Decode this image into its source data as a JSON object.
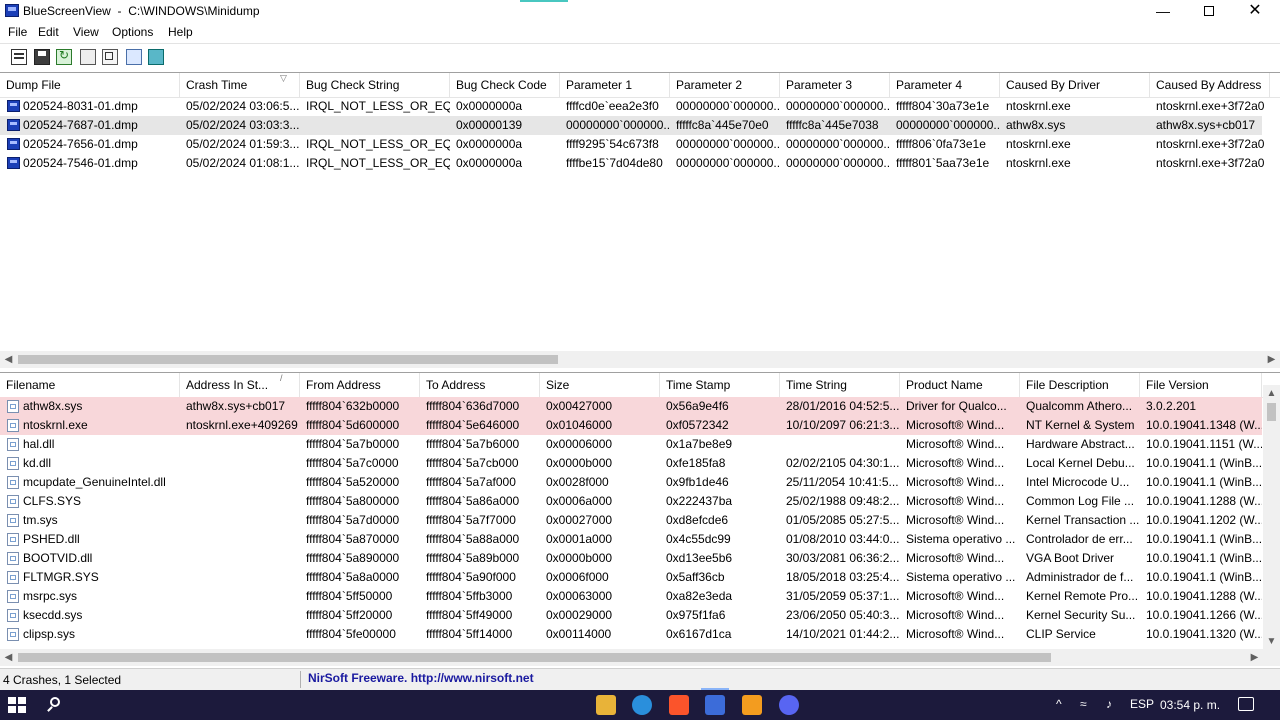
{
  "window": {
    "app_name": "BlueScreenView",
    "path": "C:\\WINDOWS\\Minidump",
    "minimize_glyph": "—",
    "close_glyph": "✕"
  },
  "menu": [
    "File",
    "Edit",
    "View",
    "Options",
    "Help"
  ],
  "toolbar_icons": [
    "properties-icon",
    "save-icon",
    "refresh-icon",
    "copy-icon",
    "options-icon",
    "find-icon",
    "exit-icon"
  ],
  "crash_list": {
    "columns": [
      "Dump File",
      "Crash Time",
      "Bug Check String",
      "Bug Check Code",
      "Parameter 1",
      "Parameter 2",
      "Parameter 3",
      "Parameter 4",
      "Caused By Driver",
      "Caused By Address"
    ],
    "sorted_column": "Crash Time",
    "selected_row": 1,
    "rows": [
      [
        "020524-8031-01.dmp",
        "05/02/2024 03:06:5...",
        "IRQL_NOT_LESS_OR_EQ...",
        "0x0000000a",
        "ffffcd0e`eea2e3f0",
        "00000000`000000...",
        "00000000`000000...",
        "fffff804`30a73e1e",
        "ntoskrnl.exe",
        "ntoskrnl.exe+3f72a0"
      ],
      [
        "020524-7687-01.dmp",
        "05/02/2024 03:03:3...",
        "",
        "0x00000139",
        "00000000`000000...",
        "fffffc8a`445e70e0",
        "fffffc8a`445e7038",
        "00000000`000000...",
        "athw8x.sys",
        "athw8x.sys+cb017"
      ],
      [
        "020524-7656-01.dmp",
        "05/02/2024 01:59:3...",
        "IRQL_NOT_LESS_OR_EQ...",
        "0x0000000a",
        "ffff9295`54c673f8",
        "00000000`000000...",
        "00000000`000000...",
        "fffff806`0fa73e1e",
        "ntoskrnl.exe",
        "ntoskrnl.exe+3f72a0"
      ],
      [
        "020524-7546-01.dmp",
        "05/02/2024 01:08:1...",
        "IRQL_NOT_LESS_OR_EQ...",
        "0x0000000a",
        "ffffbe15`7d04de80",
        "00000000`000000...",
        "00000000`000000...",
        "fffff801`5aa73e1e",
        "ntoskrnl.exe",
        "ntoskrnl.exe+3f72a0"
      ]
    ]
  },
  "driver_list": {
    "columns": [
      "Filename",
      "Address In St...",
      "From Address",
      "To Address",
      "Size",
      "Time Stamp",
      "Time String",
      "Product Name",
      "File Description",
      "File Version"
    ],
    "sorted_column": "Address In St...",
    "highlighted_rows": [
      0,
      1
    ],
    "highlight_color": "#f8d7da",
    "rows": [
      [
        "athw8x.sys",
        "athw8x.sys+cb017",
        "fffff804`632b0000",
        "fffff804`636d7000",
        "0x00427000",
        "0x56a9e4f6",
        "28/01/2016 04:52:5...",
        "Driver for Qualco...",
        "Qualcomm Athero...",
        "3.0.2.201"
      ],
      [
        "ntoskrnl.exe",
        "ntoskrnl.exe+409269",
        "fffff804`5d600000",
        "fffff804`5e646000",
        "0x01046000",
        "0xf0572342",
        "10/10/2097 06:21:3...",
        "Microsoft® Wind...",
        "NT Kernel & System",
        "10.0.19041.1348 (W..."
      ],
      [
        "hal.dll",
        "",
        "fffff804`5a7b0000",
        "fffff804`5a7b6000",
        "0x00006000",
        "0x1a7be8e9",
        "",
        "Microsoft® Wind...",
        "Hardware Abstract...",
        "10.0.19041.1151 (W..."
      ],
      [
        "kd.dll",
        "",
        "fffff804`5a7c0000",
        "fffff804`5a7cb000",
        "0x0000b000",
        "0xfe185fa8",
        "02/02/2105 04:30:1...",
        "Microsoft® Wind...",
        "Local Kernel Debu...",
        "10.0.19041.1 (WinB..."
      ],
      [
        "mcupdate_GenuineIntel.dll",
        "",
        "fffff804`5a520000",
        "fffff804`5a7af000",
        "0x0028f000",
        "0x9fb1de46",
        "25/11/2054 10:41:5...",
        "Microsoft® Wind...",
        "Intel Microcode U...",
        "10.0.19041.1 (WinB..."
      ],
      [
        "CLFS.SYS",
        "",
        "fffff804`5a800000",
        "fffff804`5a86a000",
        "0x0006a000",
        "0x222437ba",
        "25/02/1988 09:48:2...",
        "Microsoft® Wind...",
        "Common Log File ...",
        "10.0.19041.1288 (W..."
      ],
      [
        "tm.sys",
        "",
        "fffff804`5a7d0000",
        "fffff804`5a7f7000",
        "0x00027000",
        "0xd8efcde6",
        "01/05/2085 05:27:5...",
        "Microsoft® Wind...",
        "Kernel Transaction ...",
        "10.0.19041.1202 (W..."
      ],
      [
        "PSHED.dll",
        "",
        "fffff804`5a870000",
        "fffff804`5a88a000",
        "0x0001a000",
        "0x4c55dc99",
        "01/08/2010 03:44:0...",
        "Sistema operativo ...",
        "Controlador de err...",
        "10.0.19041.1 (WinB..."
      ],
      [
        "BOOTVID.dll",
        "",
        "fffff804`5a890000",
        "fffff804`5a89b000",
        "0x0000b000",
        "0xd13ee5b6",
        "30/03/2081 06:36:2...",
        "Microsoft® Wind...",
        "VGA Boot Driver",
        "10.0.19041.1 (WinB..."
      ],
      [
        "FLTMGR.SYS",
        "",
        "fffff804`5a8a0000",
        "fffff804`5a90f000",
        "0x0006f000",
        "0x5aff36cb",
        "18/05/2018 03:25:4...",
        "Sistema operativo ...",
        "Administrador de f...",
        "10.0.19041.1 (WinB..."
      ],
      [
        "msrpc.sys",
        "",
        "fffff804`5ff50000",
        "fffff804`5ffb3000",
        "0x00063000",
        "0xa82e3eda",
        "31/05/2059 05:37:1...",
        "Microsoft® Wind...",
        "Kernel Remote Pro...",
        "10.0.19041.1288 (W..."
      ],
      [
        "ksecdd.sys",
        "",
        "fffff804`5ff20000",
        "fffff804`5ff49000",
        "0x00029000",
        "0x975f1fa6",
        "23/06/2050 05:40:3...",
        "Microsoft® Wind...",
        "Kernel Security Su...",
        "10.0.19041.1266 (W..."
      ],
      [
        "clipsp.sys",
        "",
        "fffff804`5fe00000",
        "fffff804`5ff14000",
        "0x00114000",
        "0x6167d1ca",
        "14/10/2021 01:44:2...",
        "Microsoft® Wind...",
        "CLIP Service",
        "10.0.19041.1320 (W..."
      ]
    ]
  },
  "status": {
    "summary": "4 Crashes, 1 Selected",
    "vendor": "NirSoft Freeware.  http://www.nirsoft.net"
  },
  "taskbar": {
    "apps": [
      "file-explorer-icon",
      "edge-icon",
      "brave-icon",
      "bluescreenview-icon",
      "app-icon",
      "discord-icon"
    ],
    "language": "ESP",
    "clock": "03:54 p. m.",
    "tray_chevron": "^"
  }
}
